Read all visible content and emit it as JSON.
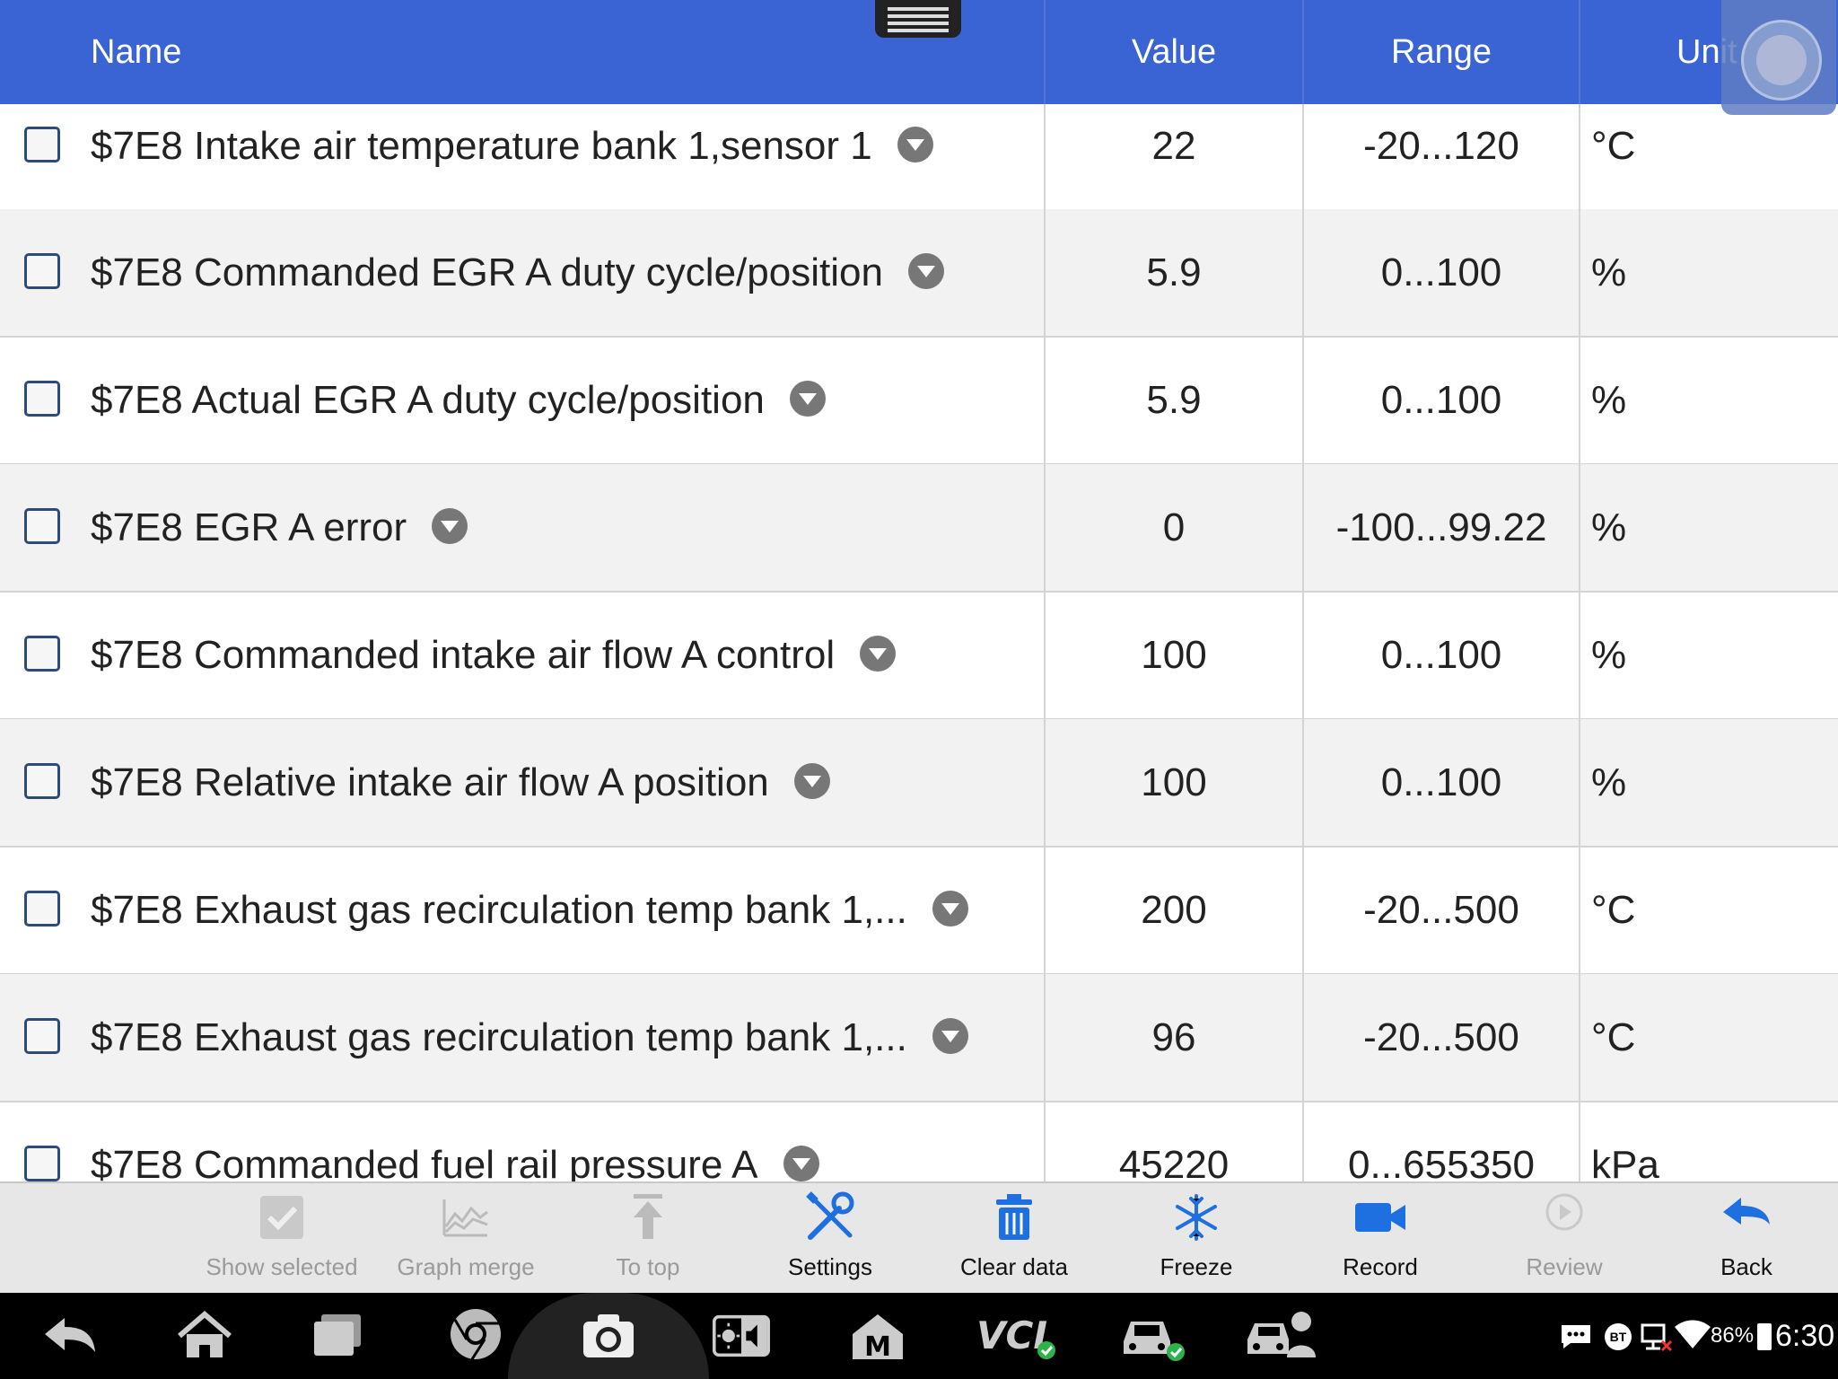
{
  "header": {
    "name_label": "Name",
    "value_label": "Value",
    "range_label": "Range",
    "unit_label": "Unit"
  },
  "rows": [
    {
      "name": "$7E8 Intake air temperature bank 1,sensor 1",
      "value": "22",
      "range": "-20...120",
      "unit": "°C"
    },
    {
      "name": "$7E8 Commanded EGR A duty cycle/position",
      "value": "5.9",
      "range": "0...100",
      "unit": "%"
    },
    {
      "name": "$7E8 Actual EGR A duty cycle/position",
      "value": "5.9",
      "range": "0...100",
      "unit": "%"
    },
    {
      "name": "$7E8 EGR A error",
      "value": "0",
      "range": "-100...99.22",
      "unit": "%"
    },
    {
      "name": "$7E8 Commanded intake air flow A control",
      "value": "100",
      "range": "0...100",
      "unit": "%"
    },
    {
      "name": "$7E8 Relative intake air flow A position",
      "value": "100",
      "range": "0...100",
      "unit": "%"
    },
    {
      "name": "$7E8 Exhaust gas recirculation temp bank 1,...",
      "value": "200",
      "range": "-20...500",
      "unit": "°C"
    },
    {
      "name": "$7E8 Exhaust gas recirculation temp bank 1,...",
      "value": "96",
      "range": "-20...500",
      "unit": "°C"
    },
    {
      "name": "$7E8 Commanded fuel rail pressure A",
      "value": "45220",
      "range": "0...655350",
      "unit": "kPa"
    }
  ],
  "toolbar": {
    "show_selected": "Show selected",
    "graph_merge": "Graph merge",
    "to_top": "To top",
    "settings": "Settings",
    "clear_data": "Clear data",
    "freeze": "Freeze",
    "record": "Record",
    "review": "Review",
    "back": "Back"
  },
  "status_bar": {
    "bt": "BT",
    "battery": "86%",
    "time": "6:30"
  },
  "colors": {
    "header_blue": "#3a64d3",
    "icon_blue": "#1e6fe0",
    "row_gray": "#f2f2f2"
  },
  "icons": [
    "checkbox-icon",
    "graph-icon",
    "arrow-up-icon",
    "tools-icon",
    "trash-icon",
    "snowflake-icon",
    "video-camera-icon",
    "play-circle-icon",
    "back-arrow-icon",
    "nav-back-icon",
    "home-icon",
    "recent-apps-icon",
    "chrome-icon",
    "camera-icon",
    "brightness-volume-icon",
    "maxifix-icon",
    "vci-icon",
    "car-connected-icon",
    "car-user-icon"
  ]
}
